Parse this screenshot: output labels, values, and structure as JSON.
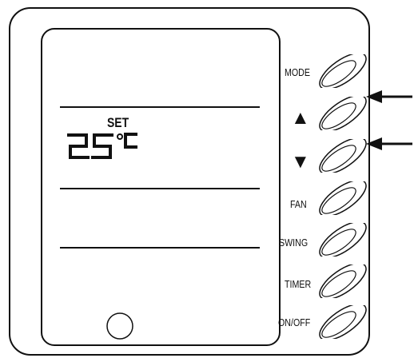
{
  "panel": {
    "display": {
      "set_label": "SET",
      "temperature": "25",
      "unit": "°C"
    },
    "buttons": [
      {
        "id": "mode",
        "label": "MODE"
      },
      {
        "id": "up",
        "label": "▲"
      },
      {
        "id": "down",
        "label": "▼"
      },
      {
        "id": "fan",
        "label": "FAN"
      },
      {
        "id": "swing",
        "label": "SWING"
      },
      {
        "id": "timer",
        "label": "TIMER"
      },
      {
        "id": "onoff",
        "label": "ON/OFF"
      }
    ]
  },
  "colors": {
    "line": "#111111",
    "background": "#ffffff"
  }
}
